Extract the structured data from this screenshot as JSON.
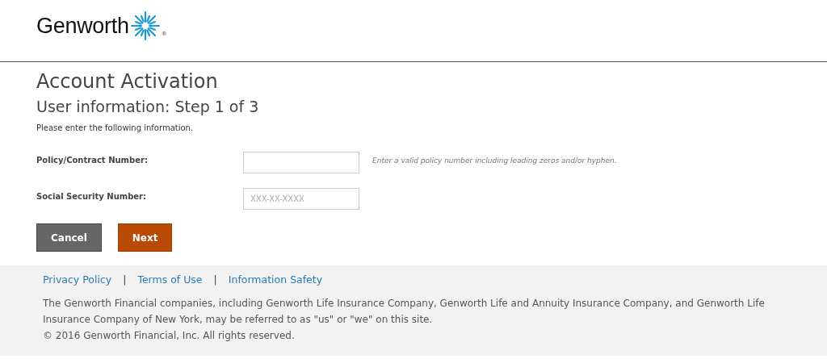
{
  "header": {
    "logo": {
      "wordmark": "Genworth",
      "mark": "®"
    }
  },
  "page": {
    "title": "Account Activation",
    "subtitle": "User information: Step 1 of 3",
    "instructions": "Please enter the following information."
  },
  "fields": [
    {
      "label": "Policy/Contract Number:",
      "hint": "Enter a valid policy number including leading zeros and/or hyphen."
    },
    {
      "label": "Social Security Number:",
      "placeholder": "XXX-XX-XXXX"
    }
  ],
  "buttons": [
    {
      "label": "Cancel",
      "kind": "secondary"
    },
    {
      "label": "Next",
      "kind": "primary"
    }
  ],
  "footer": {
    "links": [
      {
        "kind": "link",
        "text": "Privacy Policy"
      },
      {
        "kind": "separator",
        "text": "|"
      },
      {
        "kind": "link",
        "text": "Terms of Use"
      },
      {
        "kind": "separator",
        "text": "|"
      },
      {
        "kind": "link",
        "text": "Information Safety"
      }
    ],
    "disclaimer": "The Genworth Financial companies, including Genworth Life Insurance Company, Genworth Life and Annuity Insurance Company, and Genworth Life Insurance Company of New York, may be referred to as \"us\" or \"we\" on this site.",
    "copyright": "© 2016 Genworth Financial, Inc. All rights reserved."
  }
}
